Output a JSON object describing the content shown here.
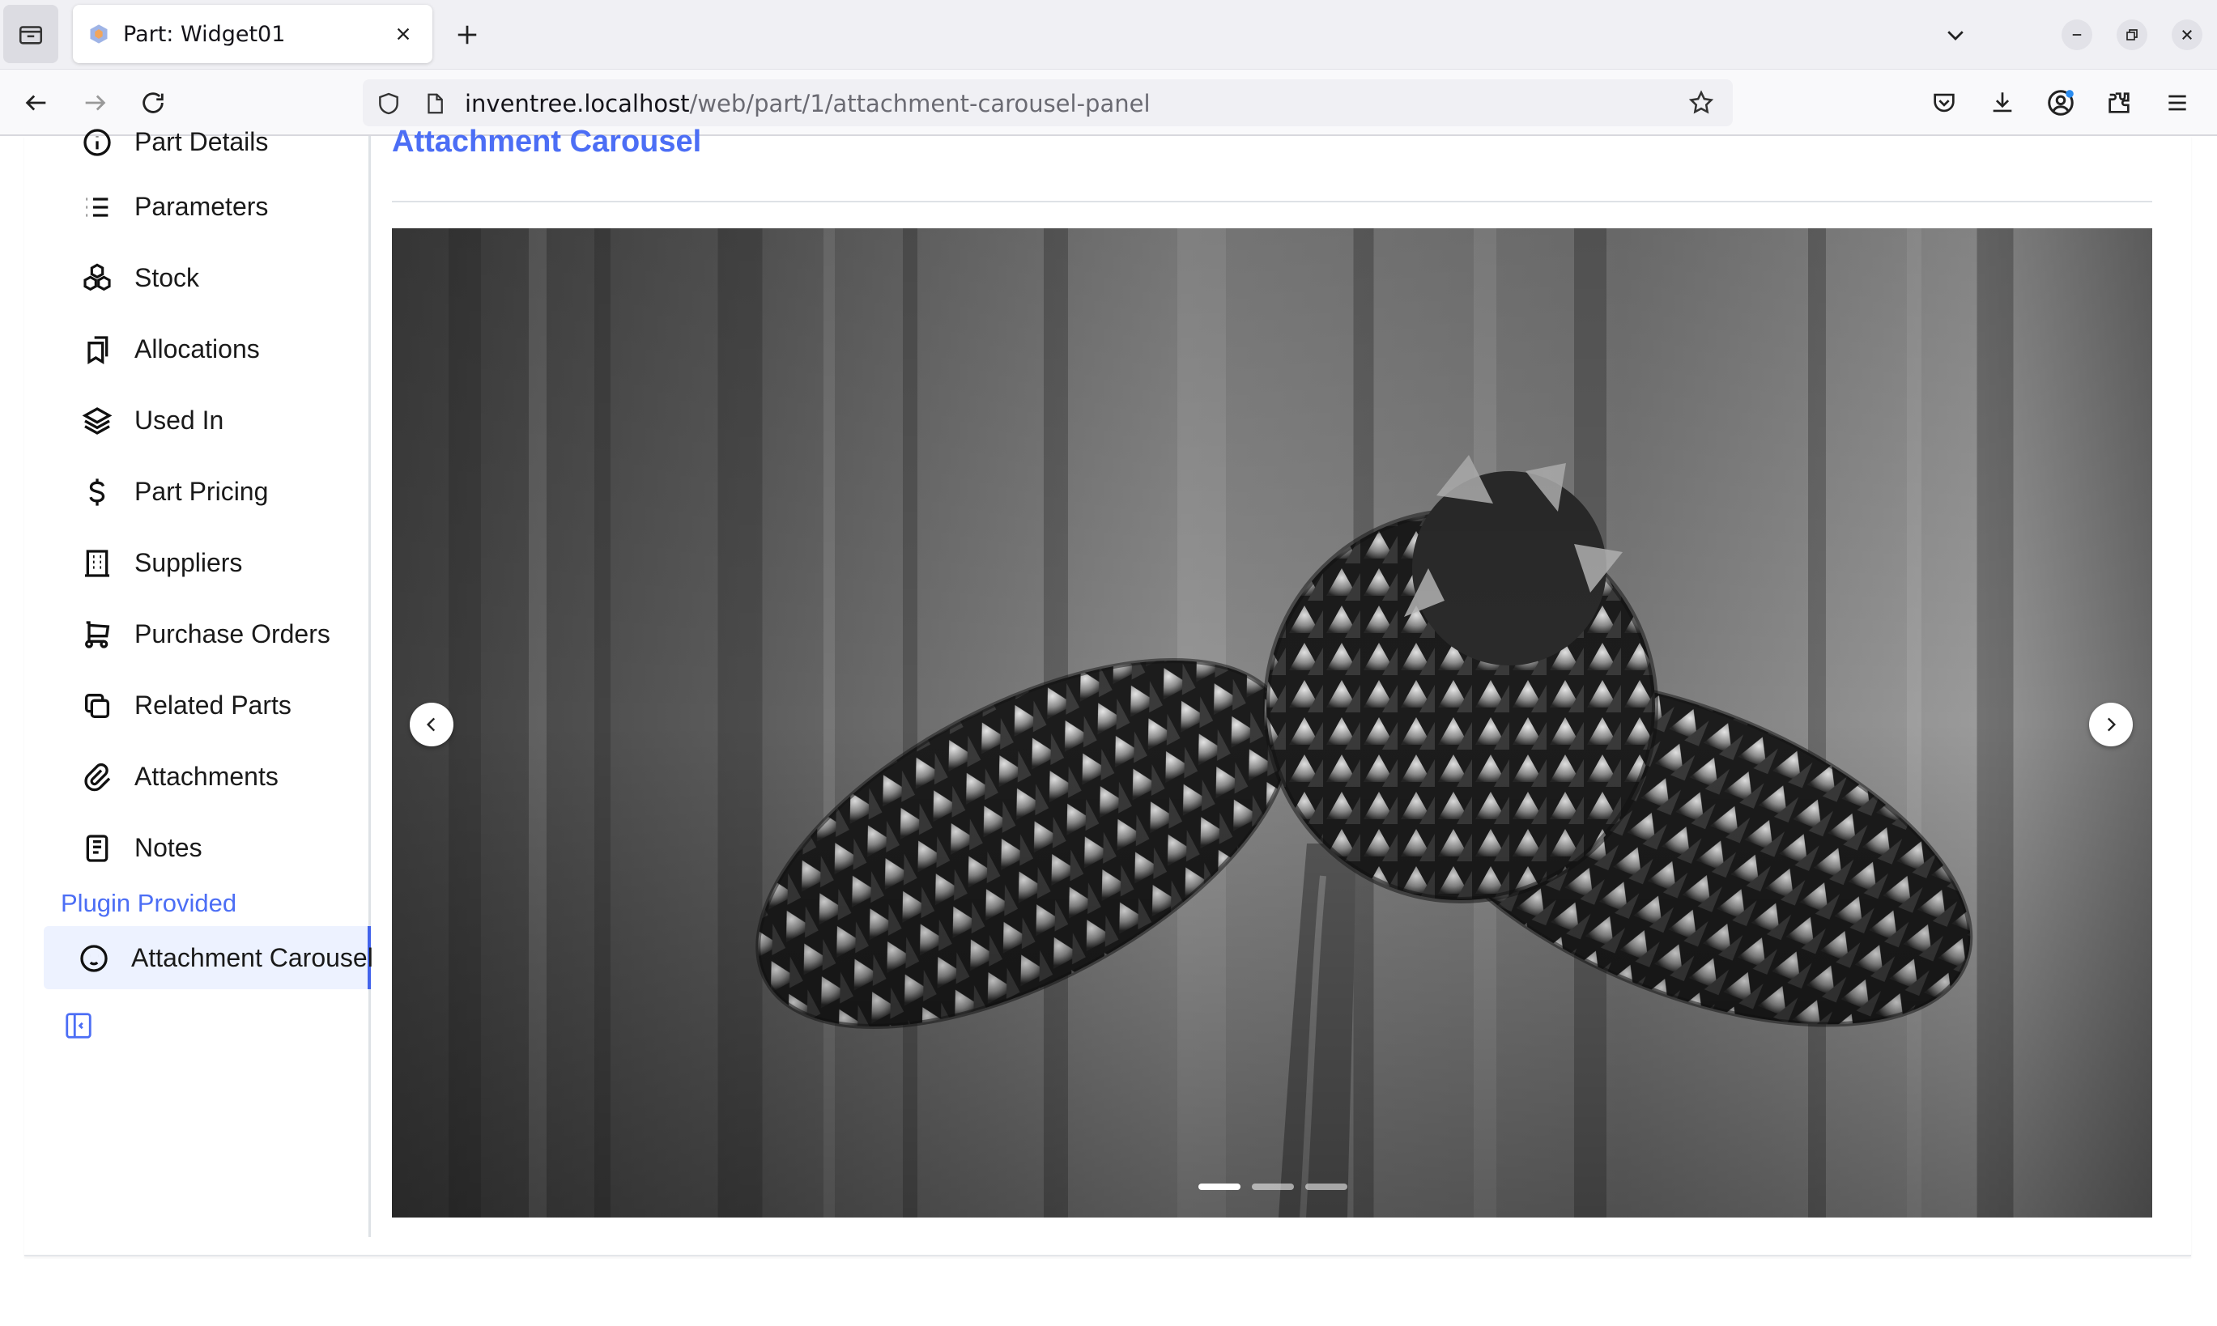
{
  "browser": {
    "tab": {
      "title": "Part: Widget01"
    },
    "url": {
      "host": "inventree.localhost",
      "path": "/web/part/1/attachment-carousel-panel"
    }
  },
  "sidebar": {
    "items": [
      {
        "label": "Part Details",
        "icon": "info-circle-icon"
      },
      {
        "label": "Parameters",
        "icon": "list-icon"
      },
      {
        "label": "Stock",
        "icon": "packages-icon"
      },
      {
        "label": "Allocations",
        "icon": "bookmarks-icon"
      },
      {
        "label": "Used In",
        "icon": "stack-icon"
      },
      {
        "label": "Part Pricing",
        "icon": "dollar-icon"
      },
      {
        "label": "Suppliers",
        "icon": "building-icon"
      },
      {
        "label": "Purchase Orders",
        "icon": "shopping-cart-icon"
      },
      {
        "label": "Related Parts",
        "icon": "copy-icon"
      },
      {
        "label": "Attachments",
        "icon": "paperclip-icon"
      },
      {
        "label": "Notes",
        "icon": "notes-icon"
      }
    ],
    "plugin_group_label": "Plugin Provided",
    "plugin_items": [
      {
        "label": "Attachment Carousel",
        "icon": "mood-smile-icon",
        "active": true
      }
    ]
  },
  "panel": {
    "title": "Attachment Carousel",
    "carousel": {
      "slide_count": 3,
      "active_index": 0
    }
  },
  "colors": {
    "accent": "#4c6ef5",
    "active_bg": "#edf2ff"
  }
}
